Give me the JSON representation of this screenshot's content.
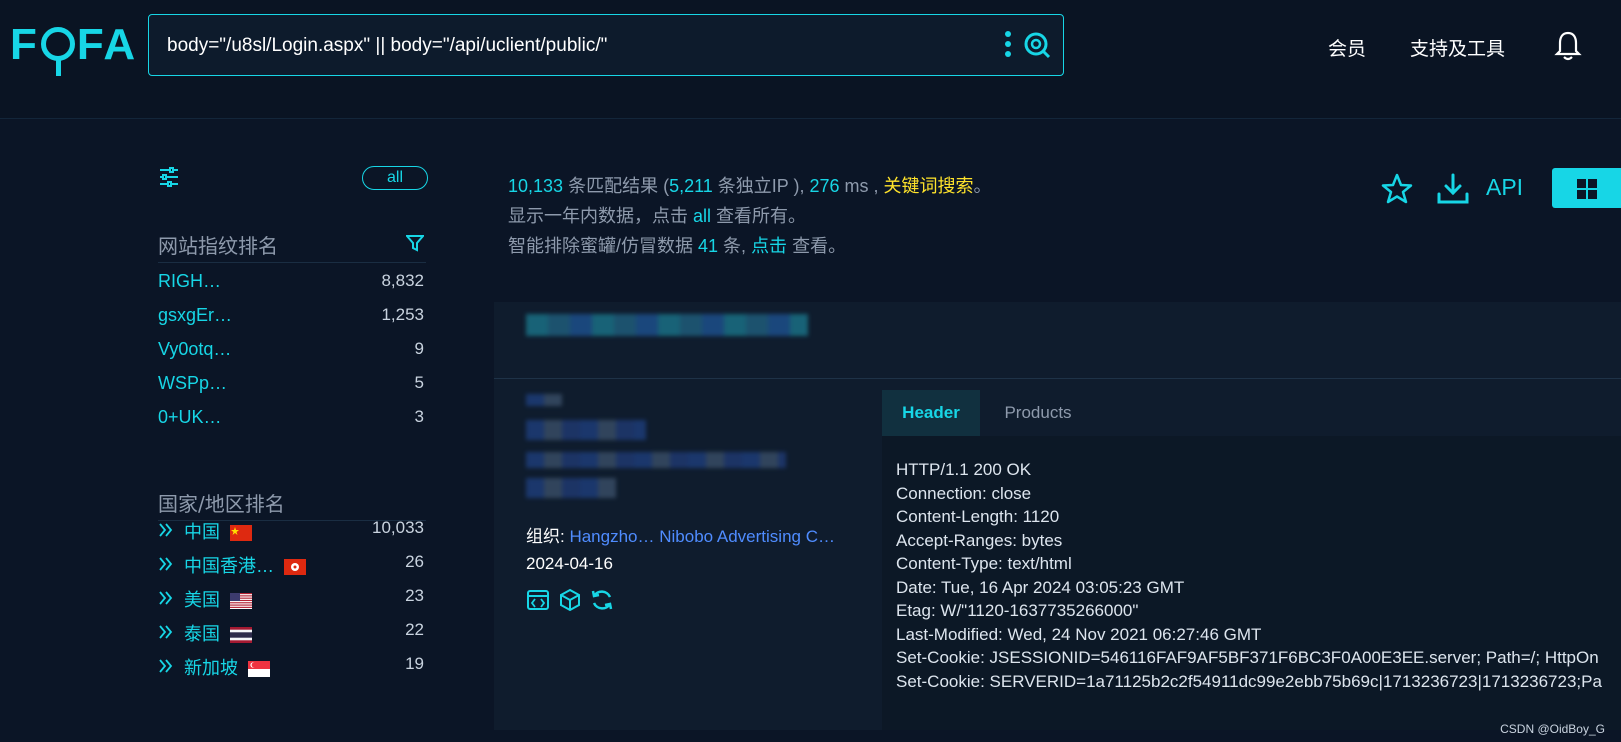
{
  "logo": {
    "text": "FOFA"
  },
  "search": {
    "query": "body=\"/u8sl/Login.aspx\" || body=\"/api/uclient/public/\""
  },
  "nav": {
    "member": "会员",
    "tools": "支持及工具"
  },
  "sidebar": {
    "all_label": "all",
    "fingerprint_title": "网站指纹排名",
    "fingerprints": [
      {
        "name": "RIGH…",
        "count": "8,832"
      },
      {
        "name": "gsxgEr…",
        "count": "1,253"
      },
      {
        "name": "Vy0otq…",
        "count": "9"
      },
      {
        "name": "WSPp…",
        "count": "5"
      },
      {
        "name": "0+UK…",
        "count": "3"
      }
    ],
    "country_title": "国家/地区排名",
    "countries": [
      {
        "name": "中国",
        "count": "10,033",
        "flag": "cn"
      },
      {
        "name": "中国香港…",
        "count": "26",
        "flag": "hk"
      },
      {
        "name": "美国",
        "count": "23",
        "flag": "us"
      },
      {
        "name": "泰国",
        "count": "22",
        "flag": "th"
      },
      {
        "name": "新加坡",
        "count": "19",
        "flag": "sg"
      }
    ]
  },
  "summary": {
    "total": "10,133",
    "total_suffix": " 条匹配结果 (",
    "ips": "5,211",
    "ips_suffix": " 条独立IP ), ",
    "ms": "276",
    "ms_suffix": " ms , ",
    "keyword": "关键词搜索",
    "end": "。",
    "line2_pre": "显示一年内数据，点击 ",
    "line2_all": "all",
    "line2_post": " 查看所有。",
    "line3_pre": "智能排除蜜罐/仿冒数据 ",
    "line3_num": "41",
    "line3_mid": " 条, ",
    "line3_link": "点击",
    "line3_post": " 查看。"
  },
  "actions": {
    "api_label": "API"
  },
  "result": {
    "org_label": "组织: ",
    "org_value": "Hangzho… Nibobo Advertising C…",
    "date": "2024-04-16",
    "tabs": [
      "Header",
      "Products"
    ],
    "header_lines": [
      "HTTP/1.1 200 OK",
      "Connection: close",
      "Content-Length: 1120",
      "Accept-Ranges: bytes",
      "Content-Type: text/html",
      "Date: Tue, 16 Apr 2024 03:05:23 GMT",
      "Etag: W/\"1120-1637735266000\"",
      "Last-Modified: Wed, 24 Nov 2021 06:27:46 GMT",
      "Set-Cookie: JSESSIONID=546116FAF9AF5BF371F6BC3F0A00E3EE.server; Path=/; HttpOn",
      "Set-Cookie: SERVERID=1a71125b2c2f54911dc99e2ebb75b69c|1713236723|1713236723;Pa"
    ]
  },
  "watermark": "CSDN @OidBoy_G",
  "colors": {
    "accent": "#17d6e6",
    "keyword": "#ffe32b",
    "link": "#4f8cff",
    "bg": "#0b1526"
  }
}
